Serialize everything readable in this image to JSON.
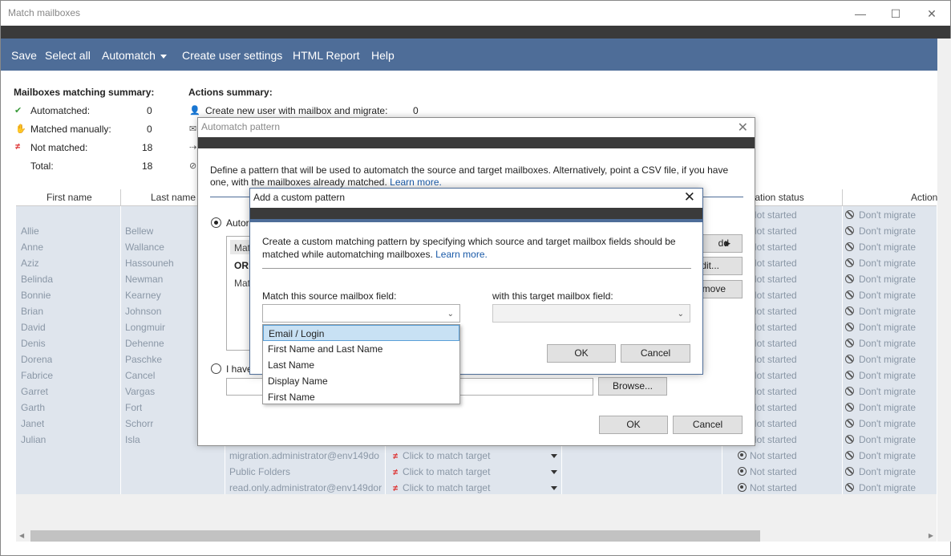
{
  "window": {
    "title": "Match mailboxes",
    "minimize": "—",
    "maximize": "☐",
    "close": "✕"
  },
  "toolbar": {
    "save": "Save",
    "select_all": "Select all",
    "automatch": "Automatch",
    "create_user_settings": "Create user settings",
    "html_report": "HTML Report",
    "help": "Help"
  },
  "mailbox_summary": {
    "heading": "Mailboxes matching summary:",
    "rows": [
      {
        "label": "Automatched:",
        "value": "0"
      },
      {
        "label": "Matched manually:",
        "value": "0"
      },
      {
        "label": "Not matched:",
        "value": "18"
      },
      {
        "label": "Total:",
        "value": "18"
      }
    ]
  },
  "actions_summary": {
    "heading": "Actions summary:",
    "rows": [
      {
        "label": "Create new user with mailbox and migrate:",
        "value": "0"
      }
    ]
  },
  "grid": {
    "headers": {
      "first_name": "First name",
      "last_name": "Last name",
      "migration_status": "Migration status",
      "action": "Action"
    },
    "status_text": "Not started",
    "action_text": "Don't migrate",
    "match_text": "Click to match target",
    "rows": [
      {
        "first": "",
        "last": ""
      },
      {
        "first": "Allie",
        "last": "Bellew"
      },
      {
        "first": "Anne",
        "last": "Wallance"
      },
      {
        "first": "Aziz",
        "last": "Hassouneh"
      },
      {
        "first": "Belinda",
        "last": "Newman"
      },
      {
        "first": "Bonnie",
        "last": "Kearney"
      },
      {
        "first": "Brian",
        "last": "Johnson"
      },
      {
        "first": "David",
        "last": "Longmuir"
      },
      {
        "first": "Denis",
        "last": "Dehenne"
      },
      {
        "first": "Dorena",
        "last": "Paschke"
      },
      {
        "first": "Fabrice",
        "last": "Cancel"
      },
      {
        "first": "Garret",
        "last": "Vargas"
      },
      {
        "first": "Garth",
        "last": "Fort"
      },
      {
        "first": "Janet",
        "last": "Schorr"
      },
      {
        "first": "Julian",
        "last": "Isla"
      },
      {
        "first": "",
        "last": "",
        "source": "migration.administrator@env149do"
      },
      {
        "first": "",
        "last": "",
        "source": "Public Folders"
      },
      {
        "first": "",
        "last": "",
        "source": "read.only.administrator@env149dor"
      }
    ]
  },
  "automatch_dialog": {
    "title": "Automatch pattern",
    "description": "Define a pattern that will be used to automatch the source and target mailboxes. Alternatively, point a CSV file, if you have one, with the mailboxes already matched.",
    "learn_more": "Learn more.",
    "radio_auto": "Autor",
    "radio_csv": "I have",
    "list_items": [
      "Mat",
      "OR",
      "Mat"
    ],
    "add_button": "dd",
    "edit_button": "dit...",
    "remove_button": "move",
    "browse": "Browse...",
    "ok": "OK",
    "cancel": "Cancel"
  },
  "custom_dialog": {
    "title": "Add a custom pattern",
    "description": "Create a custom matching pattern by specifying which source and target mailbox fields should be matched while automatching mailboxes.",
    "learn_more": "Learn more.",
    "source_label": "Match this source mailbox field:",
    "target_label": "with this target mailbox field:",
    "ok": "OK",
    "cancel": "Cancel",
    "dropdown_options": [
      "Email / Login",
      "First Name and Last Name",
      "Last Name",
      "Display Name",
      "First Name"
    ],
    "selected_option": "Email / Login"
  },
  "colors": {
    "toolbar": "#4e6d98",
    "dark_band": "#3a3a3a",
    "grid_bg": "#dfe5ed",
    "link": "#1a5aa8",
    "selection": "#c8e1f4"
  }
}
